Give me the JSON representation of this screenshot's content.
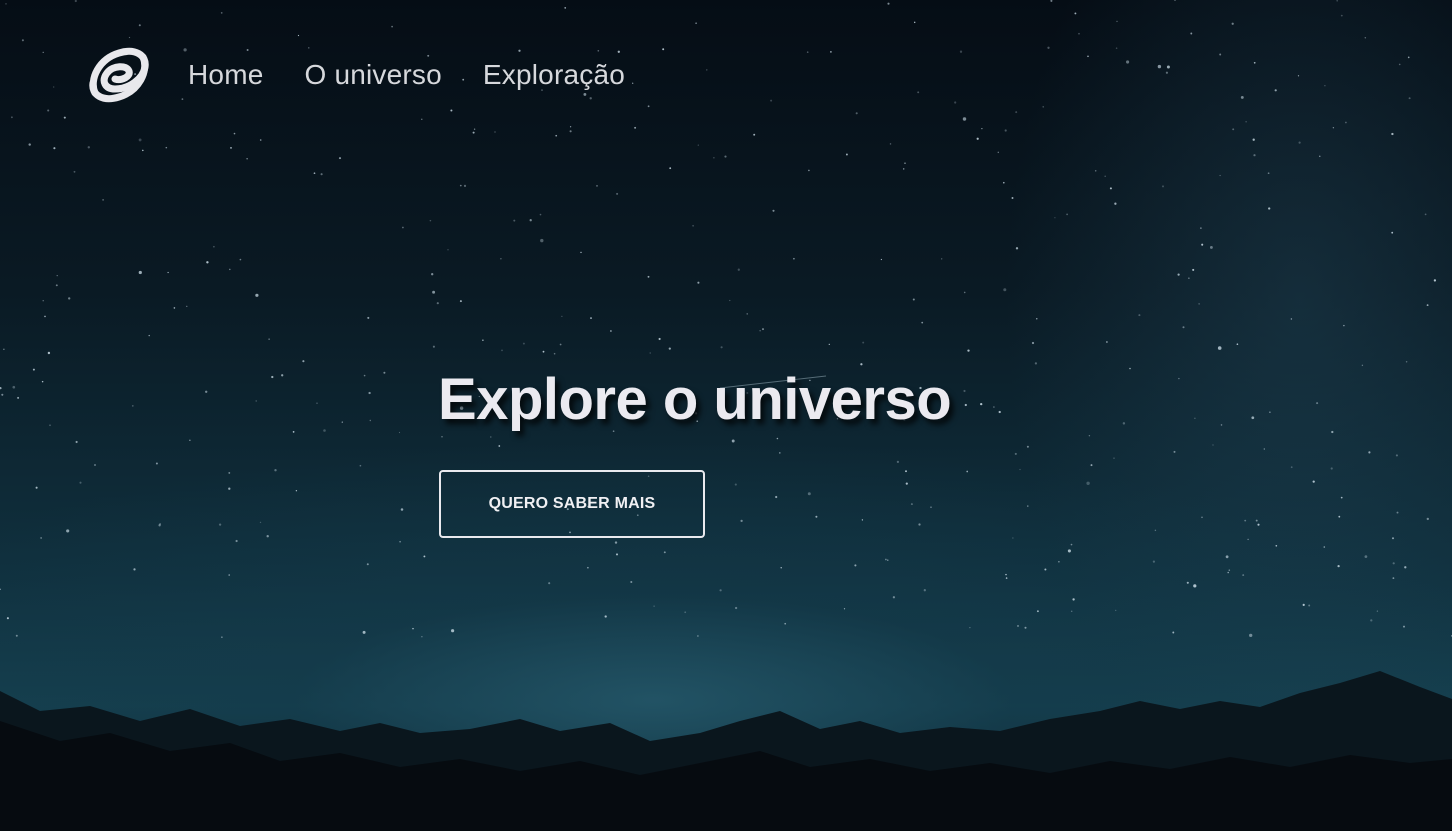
{
  "nav": {
    "logo": "galaxy-swirl-logo",
    "links": [
      {
        "label": "Home"
      },
      {
        "label": "O universo"
      },
      {
        "label": "Exploração"
      }
    ]
  },
  "hero": {
    "headline": "Explore o universo",
    "cta_label": "QUERO SABER MAIS"
  },
  "colors": {
    "sky_top": "#050d15",
    "sky_horizon": "#15404f",
    "mountains": "#070d12",
    "text_primary": "#ebeaf0",
    "nav_text": "#d6d8dc",
    "button_border": "#e9e9ee"
  }
}
